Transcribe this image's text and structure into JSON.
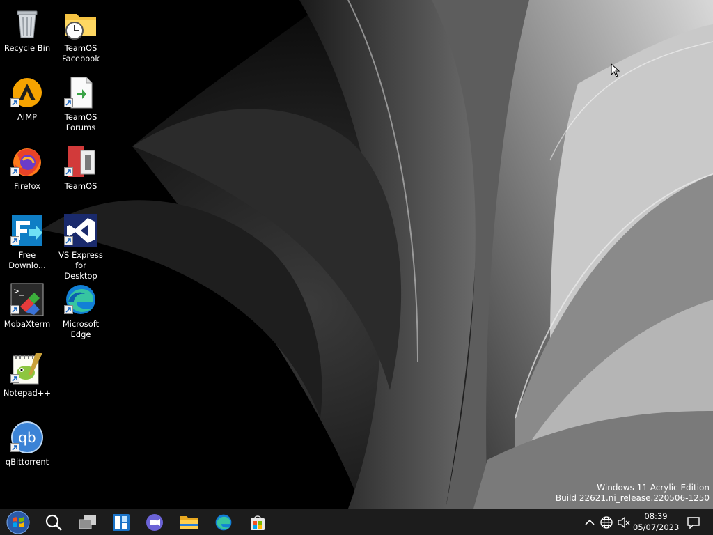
{
  "desktop": {
    "icons": [
      {
        "label": "Recycle Bin",
        "icon": "recycle-bin-icon"
      },
      {
        "label": "TeamOS\nFacebook",
        "icon": "folder-clock-icon"
      },
      {
        "label": "AIMP",
        "icon": "aimp-icon"
      },
      {
        "label": "TeamOS\nForums",
        "icon": "document-shortcut-icon"
      },
      {
        "label": "Firefox",
        "icon": "firefox-icon"
      },
      {
        "label": "TeamOS",
        "icon": "teamos-icon"
      },
      {
        "label": "Free\nDownlo...",
        "icon": "free-download-manager-icon"
      },
      {
        "label": "VS Express for\nDesktop",
        "icon": "visual-studio-icon"
      },
      {
        "label": "MobaXterm",
        "icon": "mobaxterm-icon"
      },
      {
        "label": "Microsoft\nEdge",
        "icon": "edge-icon"
      },
      {
        "label": "Notepad++",
        "icon": "notepadpp-icon"
      },
      {
        "label": "qBittorrent",
        "icon": "qbittorrent-icon"
      }
    ]
  },
  "watermark": {
    "line1": "Windows 11 Acrylic Edition",
    "line2": "Build 22621.ni_release.220506-1250"
  },
  "taskbar": {
    "buttons": [
      {
        "name": "start-button",
        "icon": "windows-orb-icon"
      },
      {
        "name": "search-button",
        "icon": "search-icon"
      },
      {
        "name": "task-view-button",
        "icon": "task-view-icon"
      },
      {
        "name": "widgets-button",
        "icon": "widgets-icon"
      },
      {
        "name": "chat-button",
        "icon": "teams-chat-icon"
      },
      {
        "name": "file-explorer-button",
        "icon": "folder-icon"
      },
      {
        "name": "edge-taskbar-button",
        "icon": "edge-icon"
      },
      {
        "name": "store-button",
        "icon": "store-icon"
      }
    ],
    "tray": {
      "icons": [
        "chevron-up-icon",
        "network-globe-icon",
        "volume-muted-icon",
        "notification-icon"
      ],
      "time": "08:39",
      "date": "05/07/2023"
    }
  },
  "colors": {
    "taskbar_bg": "#1c1c1c",
    "desktop_bg": "#000000"
  }
}
